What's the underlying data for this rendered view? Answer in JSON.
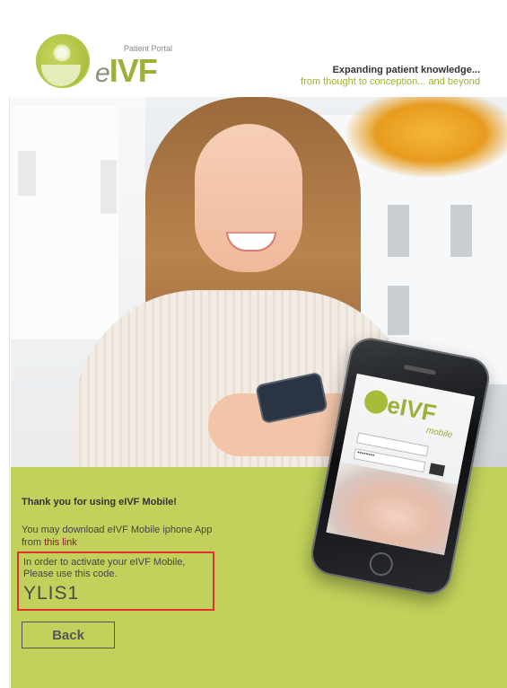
{
  "header": {
    "logo_small": "Patient Portal",
    "logo_brand_e": "e",
    "logo_brand_rest": "IVF",
    "tagline_main": "Expanding patient knowledge...",
    "tagline_sub": "from thought to conception... and beyond"
  },
  "phone": {
    "brand": "eIVF",
    "sub": "mobile",
    "field_user": "",
    "field_password": "••••••••"
  },
  "panel": {
    "thanks": "Thank you for using eIVF Mobile!",
    "download_text": "You may download eIVF Mobile iphone App",
    "download_from": "from ",
    "download_link": "this link",
    "code_line1": "In order to activate your eIVF Mobile,",
    "code_line2": "Please use this code.",
    "code_value": "YLIS1",
    "back_label": "Back"
  },
  "colors": {
    "brand_green": "#9bb13a",
    "panel_green": "#c2d15b",
    "highlight_red": "#e0332e",
    "link": "#8b1a2c"
  }
}
